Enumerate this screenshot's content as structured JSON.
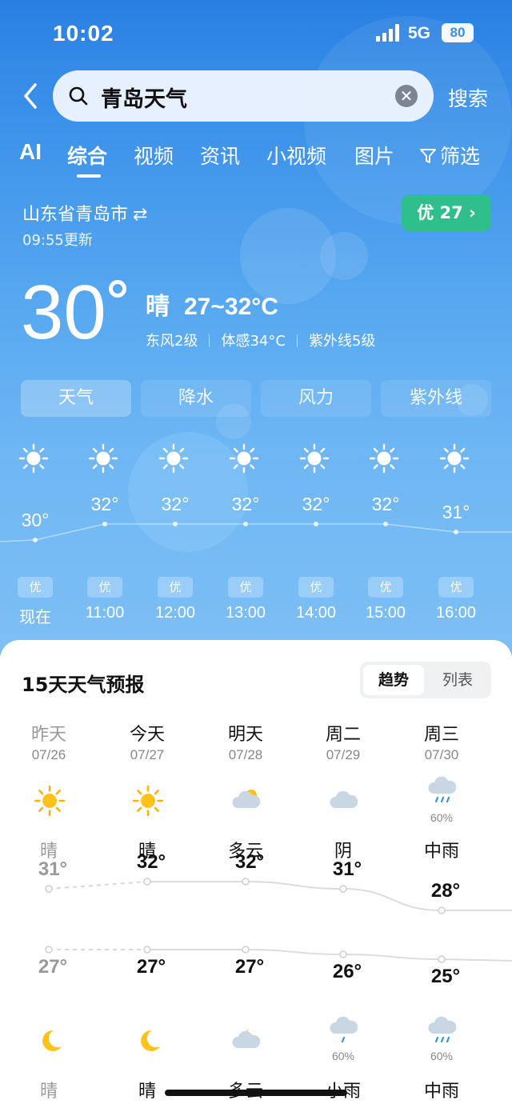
{
  "status_bar": {
    "time": "10:02",
    "network": "5G",
    "battery": "80"
  },
  "search": {
    "query": "青岛天气",
    "button_label": "搜索"
  },
  "tabs": [
    {
      "label": "AI"
    },
    {
      "label": "综合",
      "active": true
    },
    {
      "label": "视频"
    },
    {
      "label": "资讯"
    },
    {
      "label": "小视频"
    },
    {
      "label": "图片"
    },
    {
      "label": "筛选"
    }
  ],
  "location": {
    "name": "山东省青岛市",
    "updated": "09:55更新"
  },
  "aqi_badge": {
    "label": "优 27",
    "color": "#2fbf8c"
  },
  "current": {
    "temp": "30",
    "condition": "晴",
    "range": "27~32°C",
    "wind": "东风2级",
    "feels_like": "体感34°C",
    "uv": "紫外线5级"
  },
  "segments": [
    {
      "label": "天气",
      "active": true
    },
    {
      "label": "降水"
    },
    {
      "label": "风力"
    },
    {
      "label": "紫外线"
    }
  ],
  "hourly": [
    {
      "time": "现在",
      "temp": "30°",
      "value": 30,
      "aqi": "优",
      "icon": "sun-icon"
    },
    {
      "time": "11:00",
      "temp": "32°",
      "value": 32,
      "aqi": "优",
      "icon": "sun-icon"
    },
    {
      "time": "12:00",
      "temp": "32°",
      "value": 32,
      "aqi": "优",
      "icon": "sun-icon"
    },
    {
      "time": "13:00",
      "temp": "32°",
      "value": 32,
      "aqi": "优",
      "icon": "sun-icon"
    },
    {
      "time": "14:00",
      "temp": "32°",
      "value": 32,
      "aqi": "优",
      "icon": "sun-icon"
    },
    {
      "time": "15:00",
      "temp": "32°",
      "value": 32,
      "aqi": "优",
      "icon": "sun-icon"
    },
    {
      "time": "16:00",
      "temp": "31°",
      "value": 31,
      "aqi": "优",
      "icon": "sun-icon"
    }
  ],
  "forecast": {
    "title": "15天天气预报",
    "toggle": {
      "trend": "趋势",
      "list": "列表"
    },
    "days": [
      {
        "name": "昨天",
        "date": "07/26",
        "icon": "sun-icon",
        "day_cond": "晴",
        "high": "31°",
        "high_value": 31,
        "low": "27°",
        "low_value": 27,
        "night_icon": "moon-icon",
        "night_cond": "晴",
        "day_pct": "",
        "night_pct": "",
        "past": true
      },
      {
        "name": "今天",
        "date": "07/27",
        "icon": "sun-icon",
        "day_cond": "晴",
        "high": "32°",
        "high_value": 32,
        "low": "27°",
        "low_value": 27,
        "night_icon": "moon-icon",
        "night_cond": "晴",
        "day_pct": "",
        "night_pct": ""
      },
      {
        "name": "明天",
        "date": "07/28",
        "icon": "partly-cloudy-icon",
        "day_cond": "多云",
        "high": "32°",
        "high_value": 32,
        "low": "27°",
        "low_value": 27,
        "night_icon": "cloudy-night-icon",
        "night_cond": "多云",
        "day_pct": "",
        "night_pct": ""
      },
      {
        "name": "周二",
        "date": "07/29",
        "icon": "cloud-icon",
        "day_cond": "阴",
        "high": "31°",
        "high_value": 31,
        "low": "26°",
        "low_value": 26,
        "night_icon": "light-rain-icon",
        "night_cond": "小雨",
        "day_pct": "",
        "night_pct": "60%"
      },
      {
        "name": "周三",
        "date": "07/30",
        "icon": "rain-icon",
        "day_cond": "中雨",
        "high": "28°",
        "high_value": 28,
        "low": "25°",
        "low_value": 25,
        "night_icon": "rain-icon",
        "night_cond": "中雨",
        "day_pct": "60%",
        "night_pct": "60%"
      }
    ]
  }
}
